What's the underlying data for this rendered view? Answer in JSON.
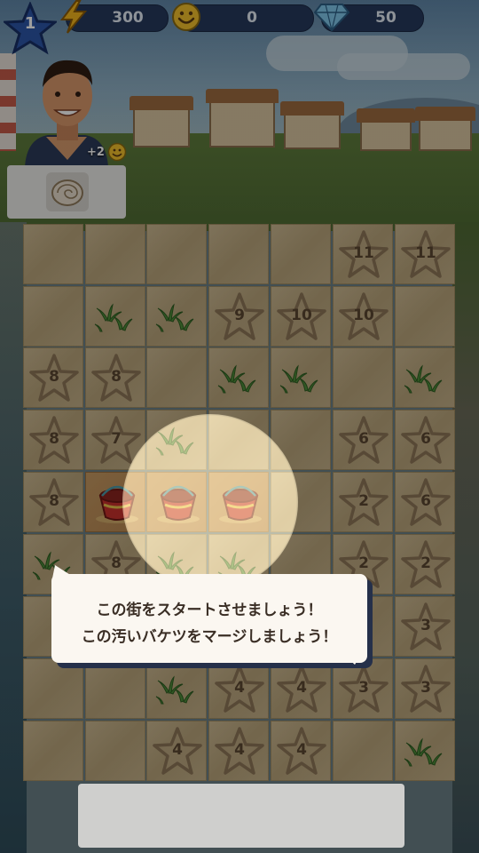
{
  "colors": {
    "bar_bg": "#25385c",
    "bolt": "#f2b51c",
    "smiley": "#f2c02c",
    "gem": "#7fc6ea",
    "tile_sand": "#c2ad84",
    "star_outline": "#8d7657",
    "bubble_bg": "#fbf7f1"
  },
  "top_bar": {
    "level": "1",
    "energy": "300",
    "smileys": "0",
    "gems": "50",
    "icons": [
      "level-star-icon",
      "energy-bolt-icon",
      "smiley-icon",
      "gem-icon"
    ]
  },
  "character": {
    "reward_text": "+2",
    "reward_icon": "smiley-icon",
    "request_item": "shell-icon"
  },
  "board": {
    "rows": [
      [
        "",
        "",
        "",
        "",
        "",
        "lock:11",
        "lock:11"
      ],
      [
        "",
        "grass",
        "grass",
        "lock:9",
        "lock:10",
        "lock:10",
        ""
      ],
      [
        "lock:8",
        "lock:8",
        "",
        "grass",
        "grass",
        "",
        "grass"
      ],
      [
        "lock:8",
        "lock:7",
        "grass",
        "",
        "",
        "lock:6",
        "lock:6"
      ],
      [
        "lock:8",
        "bucket",
        "bucket",
        "bucket",
        "",
        "lock:2",
        "lock:6"
      ],
      [
        "grass",
        "lock:8",
        "grass",
        "grass",
        "",
        "lock:2",
        "lock:2"
      ],
      [
        "",
        "",
        "",
        "",
        "",
        "",
        "lock:3"
      ],
      [
        "",
        "",
        "grass",
        "lock:4",
        "lock:4",
        "lock:3",
        "lock:3"
      ],
      [
        "",
        "",
        "lock:4",
        "lock:4",
        "lock:4",
        "",
        "grass"
      ]
    ]
  },
  "tutorial": {
    "line1": "この街をスタートさせましょう！",
    "line2": "この汚いバケツをマージしましょう！"
  }
}
